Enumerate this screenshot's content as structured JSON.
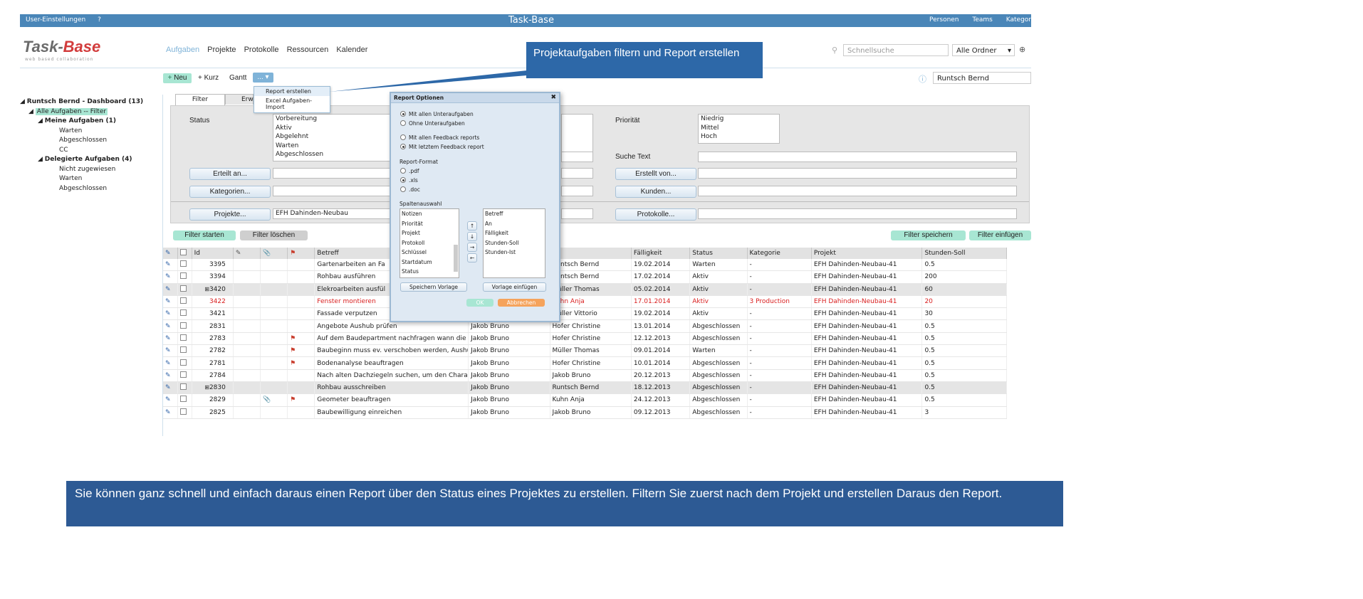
{
  "topbar": {
    "left": [
      "User-Einstellungen",
      "?"
    ],
    "title": "Task-Base",
    "right": [
      "Personen",
      "Teams",
      "Kategor"
    ]
  },
  "logo": {
    "part1": "Task-",
    "part2": "Base",
    "subtitle": "web based collaboration"
  },
  "mainnav": [
    "Aufgaben",
    "Projekte",
    "Protokolle",
    "Ressourcen",
    "Kalender"
  ],
  "search": {
    "placeholder": "Schnellsuche",
    "folder": "Alle Ordner",
    "user": "Runtsch Bernd"
  },
  "toolbar": {
    "new": "Neu",
    "short": "Kurz",
    "gantt": "Gantt",
    "more": "..."
  },
  "dropdown": {
    "items": [
      "Report erstellen",
      "Excel Aufgaben-Import"
    ]
  },
  "sidebar": {
    "root": "Runtsch Bernd - Dashboard (13)",
    "all": "Alle Aufgaben -- Filter",
    "mine": "Meine Aufgaben (1)",
    "mine_items": [
      "Warten",
      "Abgeschlossen",
      "CC"
    ],
    "delegated": "Delegierte Aufgaben (4)",
    "delegated_items": [
      "Nicht zugewiesen",
      "Warten",
      "Abgeschlossen"
    ]
  },
  "filter": {
    "tabs": [
      "Filter",
      "Erwe"
    ],
    "status_label": "Status",
    "status_options": [
      "Vorbereitung",
      "Aktiv",
      "Abgelehnt",
      "Warten",
      "Abgeschlossen"
    ],
    "priority_label": "Priorität",
    "priority_options": [
      "Niedrig",
      "Mittel",
      "Hoch"
    ],
    "search_text_label": "Suche Text",
    "btn_created_for": "Erteilt an...",
    "btn_created_by": "Erstellt von...",
    "btn_categories": "Kategorien...",
    "btn_customers": "Kunden...",
    "btn_projects": "Projekte...",
    "project_value": "EFH Dahinden-Neubau",
    "btn_protocols": "Protokolle...",
    "start": "Filter starten",
    "clear": "Filter löschen",
    "save": "Filter speichern",
    "insert": "Filter einfügen"
  },
  "dialog": {
    "title": "Report Optionen",
    "sub_with": "Mit allen Unteraufgaben",
    "sub_without": "Ohne Unteraufgaben",
    "fb_all": "Mit allen Feedback reports",
    "fb_last": "Mit letztem Feedback report",
    "format_label": "Report-Format",
    "formats": [
      ".pdf",
      ".xls",
      ".doc"
    ],
    "columns_label": "Spaltenauswahl",
    "available": [
      "Notizen",
      "Priorität",
      "Projekt",
      "Protokoll",
      "Schlüssel",
      "Startdatum",
      "Status"
    ],
    "selected": [
      "Betreff",
      "An",
      "Fälligkeit",
      "Stunden-Soll",
      "Stunden-Ist"
    ],
    "save_template": "Speichern Vorlage",
    "insert_template": "Vorlage einfügen",
    "ok": "OK",
    "cancel": "Abbrechen"
  },
  "grid": {
    "headers": [
      "",
      "",
      "Id",
      "",
      "",
      "",
      "Betreff",
      "",
      "An",
      "Fälligkeit",
      "Status",
      "Kategorie",
      "Projekt",
      "Stunden-Soll"
    ],
    "rows": [
      {
        "id": "3395",
        "betreff": "Gartenarbeiten an Fa",
        "von": "",
        "an": "Runtsch Bernd",
        "faellig": "19.02.2014",
        "status": "Warten",
        "kat": "-",
        "projekt": "EFH Dahinden-Neubau-41",
        "soll": "0.5"
      },
      {
        "id": "3394",
        "betreff": "Rohbau ausführen",
        "von": "",
        "an": "Runtsch Bernd",
        "faellig": "17.02.2014",
        "status": "Aktiv",
        "kat": "-",
        "projekt": "EFH Dahinden-Neubau-41",
        "soll": "200"
      },
      {
        "id": "3420",
        "betreff": "Elekroarbeiten ausfül",
        "von": "",
        "an": "Müller Thomas",
        "faellig": "05.02.2014",
        "status": "Aktiv",
        "kat": "-",
        "projekt": "EFH Dahinden-Neubau-41",
        "soll": "60"
      },
      {
        "id": "3422",
        "betreff": "Fenster montieren",
        "von": "",
        "an": "Kuhn Anja",
        "faellig": "17.01.2014",
        "status": "Aktiv",
        "kat": "3 Production",
        "projekt": "EFH Dahinden-Neubau-41",
        "soll": "20"
      },
      {
        "id": "3421",
        "betreff": "Fassade verputzen",
        "von": "",
        "an": "Müller Vittorio",
        "faellig": "19.02.2014",
        "status": "Aktiv",
        "kat": "-",
        "projekt": "EFH Dahinden-Neubau-41",
        "soll": "30"
      },
      {
        "id": "2831",
        "betreff": "Angebote Aushub prüfen",
        "von": "Jakob Bruno",
        "an": "Hofer Christine",
        "faellig": "13.01.2014",
        "status": "Abgeschlossen",
        "kat": "-",
        "projekt": "EFH Dahinden-Neubau-41",
        "soll": "0.5"
      },
      {
        "id": "2783",
        "betreff": "Auf dem Baudepartment nachfragen wann die Er",
        "von": "Jakob Bruno",
        "an": "Hofer Christine",
        "faellig": "12.12.2013",
        "status": "Abgeschlossen",
        "kat": "-",
        "projekt": "EFH Dahinden-Neubau-41",
        "soll": "0.5"
      },
      {
        "id": "2782",
        "betreff": "Baubeginn muss ev. verschoben werden, Aushub",
        "von": "Jakob Bruno",
        "an": "Müller Thomas",
        "faellig": "09.01.2014",
        "status": "Warten",
        "kat": "-",
        "projekt": "EFH Dahinden-Neubau-41",
        "soll": "0.5"
      },
      {
        "id": "2781",
        "betreff": "Bodenanalyse beauftragen",
        "von": "Jakob Bruno",
        "an": "Hofer Christine",
        "faellig": "10.01.2014",
        "status": "Abgeschlossen",
        "kat": "-",
        "projekt": "EFH Dahinden-Neubau-41",
        "soll": "0.5"
      },
      {
        "id": "2784",
        "betreff": "Nach alten Dachziegeln suchen, um den Charakte",
        "von": "Jakob Bruno",
        "an": "Jakob Bruno",
        "faellig": "20.12.2013",
        "status": "Abgeschlossen",
        "kat": "-",
        "projekt": "EFH Dahinden-Neubau-41",
        "soll": "0.5"
      },
      {
        "id": "2830",
        "betreff": "Rohbau ausschreiben",
        "von": "Jakob Bruno",
        "an": "Runtsch Bernd",
        "faellig": "18.12.2013",
        "status": "Abgeschlossen",
        "kat": "-",
        "projekt": "EFH Dahinden-Neubau-41",
        "soll": "0.5"
      },
      {
        "id": "2829",
        "betreff": "Geometer beauftragen",
        "von": "Jakob Bruno",
        "an": "Kuhn Anja",
        "faellig": "24.12.2013",
        "status": "Abgeschlossen",
        "kat": "-",
        "projekt": "EFH Dahinden-Neubau-41",
        "soll": "0.5"
      },
      {
        "id": "2825",
        "betreff": "Baubewilligung einreichen",
        "von": "Jakob Bruno",
        "an": "Jakob Bruno",
        "faellig": "09.12.2013",
        "status": "Abgeschlossen",
        "kat": "-",
        "projekt": "EFH Dahinden-Neubau-41",
        "soll": "3"
      }
    ]
  },
  "callouts": {
    "top": "Projektaufgaben filtern und Report erstellen",
    "bottom": "Sie können ganz schnell und einfach daraus einen Report über den Status eines Projektes zu erstellen. Filtern Sie zuerst nach dem Projekt und erstellen Daraus den Report."
  }
}
